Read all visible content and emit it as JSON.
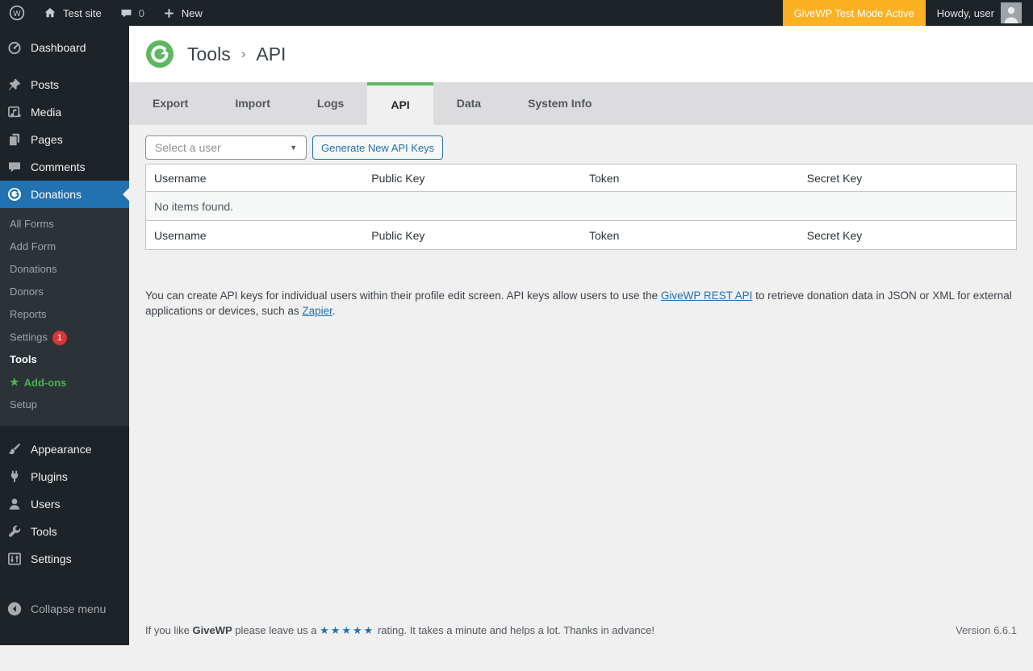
{
  "colors": {
    "accent_blue": "#2271b1",
    "givewp_green": "#5db860",
    "badge_orange": "#fcb123",
    "alert_red": "#d63638",
    "addons_green": "#46b450",
    "dark_bg": "#1d2327",
    "submenu_bg": "#2c3338",
    "tabbar_bg": "#dcdcde",
    "content_bg": "#f0f0f1"
  },
  "icons": {
    "wp_logo_letter": "W",
    "select_caret": "▼",
    "addons_star": "★"
  },
  "admin_bar": {
    "site_name": "Test site",
    "comments_count": "0",
    "new_label": "New",
    "test_mode_badge": "GiveWP Test Mode Active",
    "howdy_text": "Howdy, user"
  },
  "sidebar": {
    "main": [
      {
        "label": "Dashboard"
      },
      {
        "label": "Posts"
      },
      {
        "label": "Media"
      },
      {
        "label": "Pages"
      },
      {
        "label": "Comments"
      },
      {
        "label": "Donations"
      },
      {
        "label": "Appearance"
      },
      {
        "label": "Plugins"
      },
      {
        "label": "Users"
      },
      {
        "label": "Tools"
      },
      {
        "label": "Settings"
      },
      {
        "label": "Collapse menu"
      }
    ],
    "donations_submenu": [
      {
        "label": "All Forms"
      },
      {
        "label": "Add Form"
      },
      {
        "label": "Donations"
      },
      {
        "label": "Donors"
      },
      {
        "label": "Reports"
      },
      {
        "label": "Settings",
        "badge": "1"
      },
      {
        "label": "Tools"
      },
      {
        "label": "Add-ons"
      },
      {
        "label": "Setup"
      }
    ]
  },
  "page_header": {
    "breadcrumb_parent": "Tools",
    "separator": "›",
    "breadcrumb_current": "API"
  },
  "tabs": [
    {
      "label": "Export"
    },
    {
      "label": "Import"
    },
    {
      "label": "Logs"
    },
    {
      "label": "API"
    },
    {
      "label": "Data"
    },
    {
      "label": "System Info"
    }
  ],
  "controls": {
    "user_select_value": "Select a user",
    "generate_button_label": "Generate New API Keys"
  },
  "api_table": {
    "columns": [
      "Username",
      "Public Key",
      "Token",
      "Secret Key"
    ],
    "empty_message": "No items found."
  },
  "description": {
    "text_1": "You can create API keys for individual users within their profile edit screen. API keys allow users to use the ",
    "link_1": "GiveWP REST API",
    "text_2": " to retrieve donation data in JSON or XML for external applications or devices, such as ",
    "link_2": "Zapier",
    "text_3": "."
  },
  "footer": {
    "text_1": "If you like ",
    "brand": "GiveWP",
    "text_2": " please leave us a ",
    "stars": "★★★★★",
    "text_3": " rating. It takes a minute and helps a lot. Thanks in advance!",
    "version": "Version 6.6.1"
  }
}
